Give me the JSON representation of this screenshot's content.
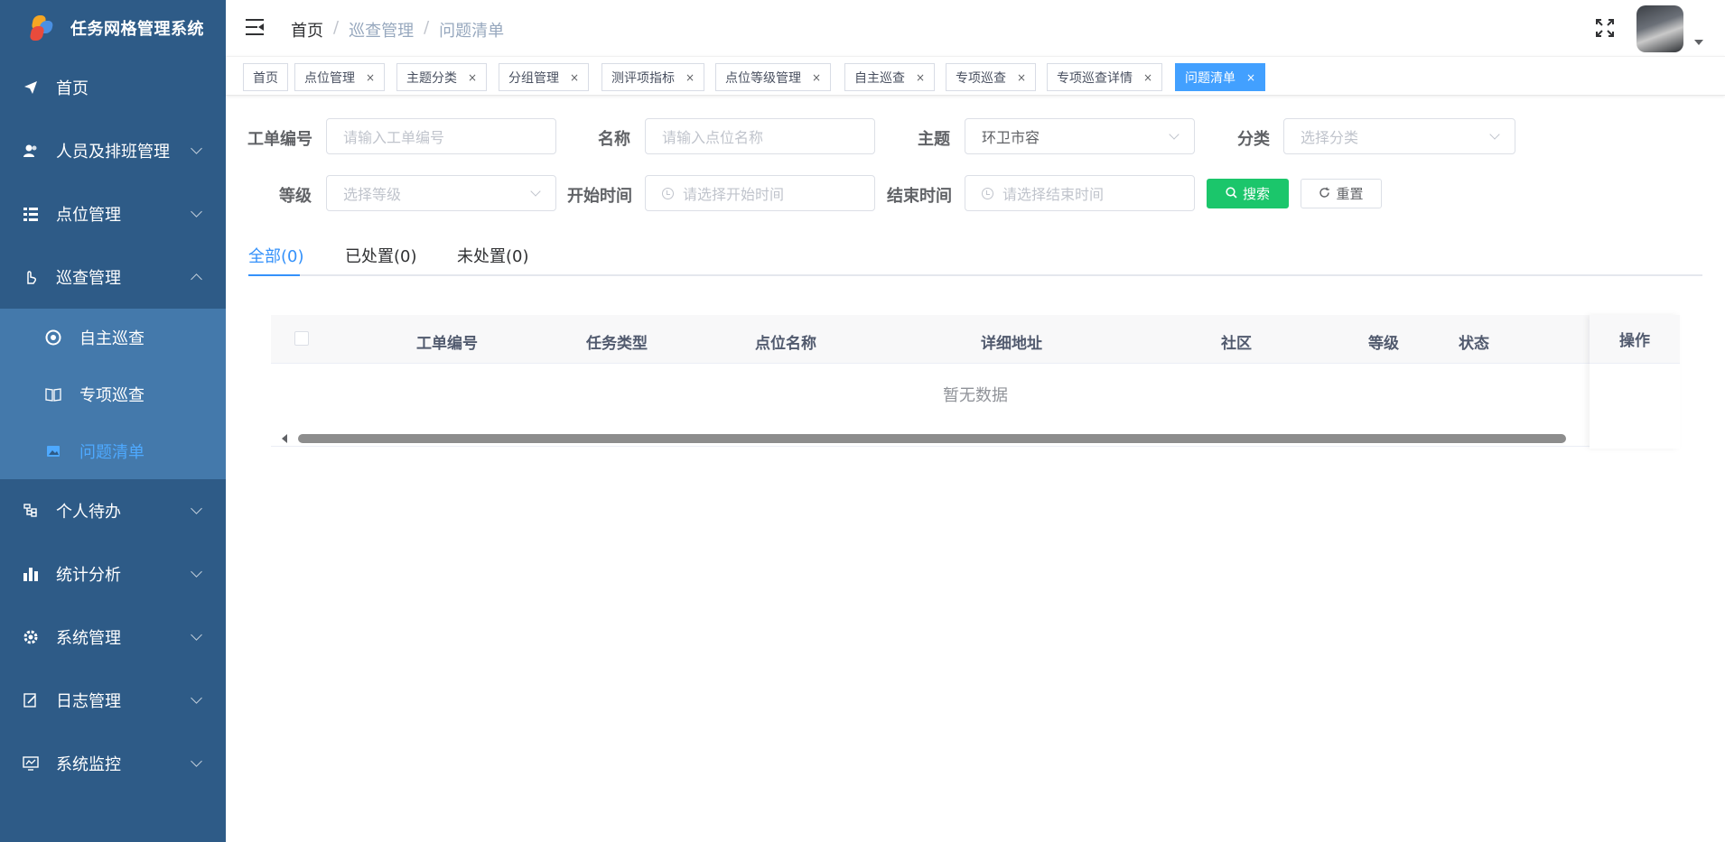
{
  "app": {
    "title": "任务网格管理系统"
  },
  "sidebar": {
    "items": [
      {
        "label": "首页",
        "icon": "send-icon"
      },
      {
        "label": "人员及排班管理",
        "icon": "people-icon"
      },
      {
        "label": "点位管理",
        "icon": "list-icon"
      },
      {
        "label": "巡查管理",
        "icon": "hand-icon"
      },
      {
        "label": "个人待办",
        "icon": "tree-icon"
      },
      {
        "label": "统计分析",
        "icon": "bar-chart-icon"
      },
      {
        "label": "系统管理",
        "icon": "gear-icon"
      },
      {
        "label": "日志管理",
        "icon": "edit-icon"
      },
      {
        "label": "系统监控",
        "icon": "monitor-icon"
      }
    ],
    "submenu": [
      {
        "label": "自主巡查",
        "icon": "aperture-icon"
      },
      {
        "label": "专项巡查",
        "icon": "book-icon"
      },
      {
        "label": "问题清单",
        "icon": "image-icon"
      }
    ],
    "active_color": "#4ea9ff"
  },
  "header": {
    "breadcrumb": [
      "首页",
      "巡查管理",
      "问题清单"
    ],
    "separator": "/"
  },
  "tags": [
    {
      "label": "首页"
    },
    {
      "label": "点位管理"
    },
    {
      "label": "主题分类"
    },
    {
      "label": "分组管理"
    },
    {
      "label": "测评项指标"
    },
    {
      "label": "点位等级管理"
    },
    {
      "label": "自主巡查"
    },
    {
      "label": "专项巡查"
    },
    {
      "label": "专项巡查详情"
    },
    {
      "label": "问题清单"
    }
  ],
  "tag_close": "×",
  "form": {
    "order_no": {
      "label": "工单编号",
      "placeholder": "请输入工单编号"
    },
    "name": {
      "label": "名称",
      "placeholder": "请输入点位名称"
    },
    "theme": {
      "label": "主题",
      "value": "环卫市容"
    },
    "category": {
      "label": "分类",
      "placeholder": "选择分类"
    },
    "level": {
      "label": "等级",
      "placeholder": "选择等级"
    },
    "start_time": {
      "label": "开始时间",
      "placeholder": "请选择开始时间"
    },
    "end_time": {
      "label": "结束时间",
      "placeholder": "请选择结束时间"
    },
    "search_label": "搜索",
    "reset_label": "重置"
  },
  "tabs": [
    {
      "label": "全部(0)"
    },
    {
      "label": "已处置(0)"
    },
    {
      "label": "未处置(0)"
    }
  ],
  "table": {
    "columns": [
      "工单编号",
      "任务类型",
      "点位名称",
      "详细地址",
      "社区",
      "等级",
      "状态"
    ],
    "action_column": "操作",
    "empty_text": "暂无数据"
  },
  "colors": {
    "sidebar_bg": "#2e5b87",
    "submenu_bg": "#4479ab",
    "tag_active": "#42a0ff",
    "search_button": "#1bc66b",
    "tab_active": "#3491fa"
  }
}
